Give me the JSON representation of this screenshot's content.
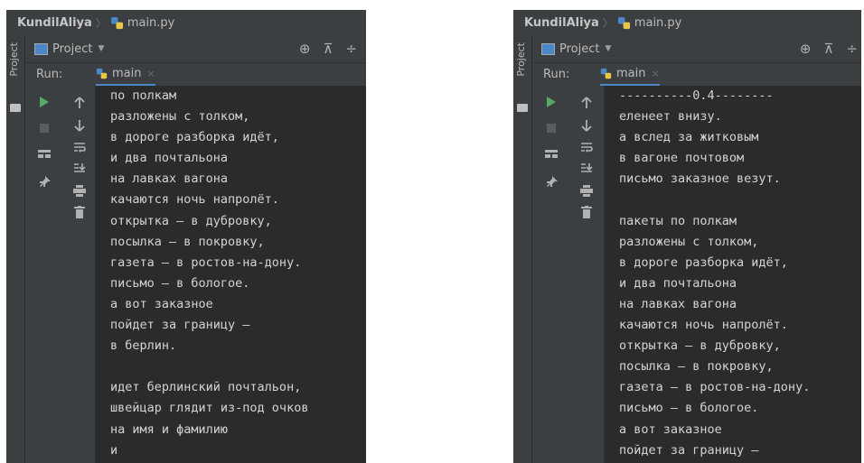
{
  "left_window": {
    "breadcrumb": {
      "project": "KundilAliya",
      "file": "main.py"
    },
    "tool_strip_label": "Project",
    "project_label": "Project",
    "run_label": "Run:",
    "run_tab": "main",
    "console_lines": [
      "по полкам",
      "разложены с толком,",
      "в дороге разборка идёт,",
      "и два почтальона",
      "на лавках вагона",
      "качаются ночь напролёт.",
      "открытка — в дубровку,",
      "посылка — в покровку,",
      "газета — в ростов-на-дону.",
      "письмо — в бологое.",
      "а вот заказное",
      "пойдет за границу —",
      "в берлин.",
      "",
      "идет берлинский почтальон,",
      "швейцар глядит из-под очков",
      "на имя и фамилию",
      "и"
    ]
  },
  "right_window": {
    "breadcrumb": {
      "project": "KundilAliya",
      "file": "main.py"
    },
    "tool_strip_label": "Project",
    "project_label": "Project",
    "run_label": "Run:",
    "run_tab": "main",
    "console_lines": [
      "----------0.4--------",
      "еленеет внизу.",
      "а вслед за житковым",
      "в вагоне почтовом",
      "письмо заказное везут.",
      "",
      "пакеты по полкам",
      "разложены с толком,",
      "в дороге разборка идёт,",
      "и два почтальона",
      "на лавках вагона",
      "качаются ночь напролёт.",
      "открытка — в дубровку,",
      "посылка — в покровку,",
      "газета — в ростов-на-дону.",
      "письмо — в бологое.",
      "а вот заказное",
      "пойдет за границу —"
    ]
  },
  "icons": {
    "run": "play-icon",
    "stop": "stop-icon",
    "layout": "layout-icon",
    "pin": "pin-icon",
    "up": "arrow-up-icon",
    "down": "arrow-down-icon",
    "wrap": "soft-wrap-icon",
    "scroll_end": "scroll-to-end-icon",
    "print": "print-icon",
    "trash": "trash-icon",
    "crosshair": "locate-icon",
    "collapse": "collapse-all-icon",
    "expand": "expand-all-icon"
  },
  "colors": {
    "run_green": "#59a869",
    "tab_underline": "#4a88c7",
    "console_bg": "#2b2b2b",
    "toolbar_bg": "#3c3f41"
  }
}
